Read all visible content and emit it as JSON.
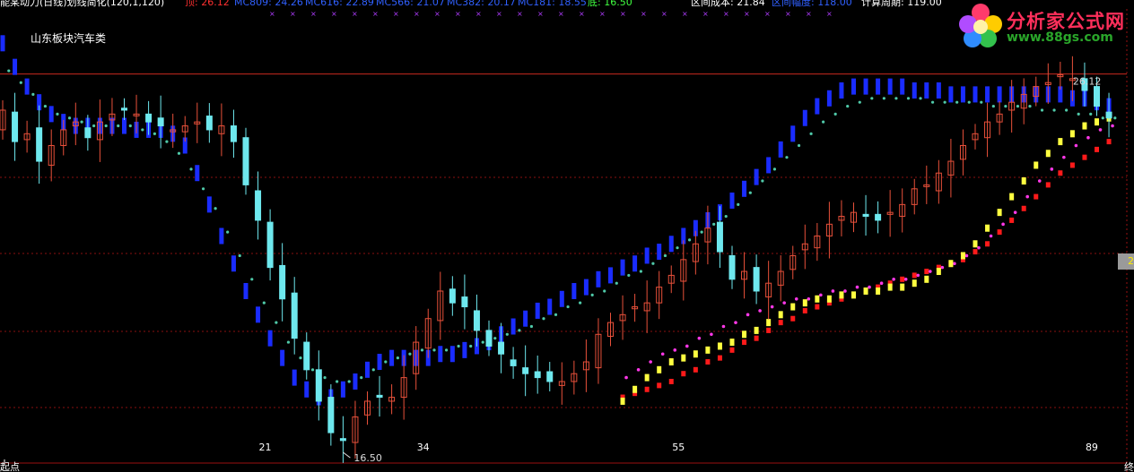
{
  "header": {
    "indicator_title": "能某动力(日线)划线简化(120,1,120)",
    "top_label": "顶: 26.12",
    "ma_items": [
      {
        "label": "MC809: 24.26",
        "color": "#3060ff"
      },
      {
        "label": "MC616: 22.89",
        "color": "#3060ff"
      },
      {
        "label": "MC566: 21.07",
        "color": "#3060ff"
      },
      {
        "label": "MC382: 20.17",
        "color": "#3060ff"
      },
      {
        "label": "MC181: 18.55",
        "color": "#3060ff"
      }
    ],
    "bottom_label": "底: 16.50",
    "cost_label": "区间成本: 21.84",
    "range_label": "区间幅度: 118.00",
    "period_label": "计算周期: 119.00"
  },
  "sector_label": "山东板块汽车类",
  "start_label": "起点",
  "end_label": "终",
  "right_tag": "2",
  "logo": {
    "title": "分析家公式网",
    "url": "www.88gs.com"
  },
  "colors": {
    "background": "#000000",
    "up_candle": "#e8503a",
    "down_candle": "#6ee8ee",
    "blue_band": "#1a2cff",
    "teal_dots": "#4fc9a8",
    "magenta_dots": "#ff38e8",
    "yellow_band": "#ffff40",
    "red_band": "#ff1a1a",
    "grid": "#8a1010",
    "label_text": "#d9d9d9",
    "header_red": "#ff3030",
    "header_white": "#ffffff",
    "header_yellow": "#ffff40",
    "header_green": "#40ff40"
  },
  "chart_data": {
    "type": "candlestick",
    "ylim": [
      16.0,
      28.0
    ],
    "high_label": "26.12",
    "low_label": "16.50",
    "x_ticks": [
      {
        "index": 21,
        "label": "21"
      },
      {
        "index": 34,
        "label": "34"
      },
      {
        "index": 55,
        "label": "55"
      },
      {
        "index": 89,
        "label": "89"
      }
    ],
    "closes": [
      25.2,
      24.4,
      24.6,
      23.9,
      24.3,
      24.7,
      24.9,
      24.5,
      24.9,
      25.1,
      25.2,
      25.1,
      24.9,
      24.8,
      24.7,
      24.8,
      24.9,
      24.7,
      24.8,
      24.4,
      23.3,
      22.4,
      21.2,
      20.4,
      19.4,
      18.6,
      17.8,
      17.0,
      16.8,
      17.4,
      17.8,
      17.9,
      17.9,
      18.4,
      19.3,
      19.9,
      20.6,
      20.3,
      20.2,
      19.6,
      19.2,
      19.0,
      18.7,
      18.5,
      18.4,
      18.3,
      18.3,
      18.5,
      18.8,
      19.5,
      19.8,
      20.0,
      20.2,
      20.3,
      20.7,
      21.0,
      21.4,
      21.8,
      22.2,
      21.6,
      20.9,
      21.1,
      20.6,
      20.8,
      21.1,
      21.5,
      21.8,
      22.0,
      22.3,
      22.5,
      22.6,
      22.5,
      22.4,
      22.6,
      22.8,
      23.2,
      23.3,
      23.6,
      23.9,
      24.3,
      24.6,
      24.9,
      25.1,
      25.4,
      25.6,
      25.8,
      25.9,
      26.1,
      26.0,
      25.7,
      25.3,
      25.0
    ],
    "ma_blue": [
      26.9,
      26.3,
      25.8,
      25.4,
      25.1,
      24.9,
      24.8,
      24.8,
      24.8,
      24.8,
      24.8,
      24.7,
      24.7,
      24.7,
      24.6,
      24.3,
      23.6,
      22.8,
      22.0,
      21.3,
      20.6,
      20.0,
      19.4,
      18.9,
      18.4,
      18.1,
      17.9,
      17.9,
      18.1,
      18.3,
      18.6,
      18.8,
      18.9,
      18.9,
      18.9,
      18.9,
      19.0,
      19.0,
      19.1,
      19.2,
      19.3,
      19.5,
      19.7,
      19.9,
      20.1,
      20.2,
      20.4,
      20.6,
      20.7,
      20.9,
      21.0,
      21.2,
      21.3,
      21.5,
      21.6,
      21.8,
      22.0,
      22.2,
      22.4,
      22.6,
      22.9,
      23.2,
      23.5,
      23.8,
      24.2,
      24.6,
      25.0,
      25.3,
      25.5,
      25.7,
      25.8,
      25.8,
      25.8,
      25.8,
      25.8,
      25.7,
      25.7,
      25.7,
      25.6,
      25.6,
      25.6,
      25.6,
      25.6,
      25.6,
      25.6,
      25.6,
      25.6,
      25.6,
      25.5,
      25.5,
      25.4,
      25.3
    ],
    "ma_teal": [
      26.2,
      25.9,
      25.6,
      25.3,
      25.1,
      25.0,
      24.9,
      24.8,
      24.8,
      24.8,
      24.8,
      24.7,
      24.6,
      24.4,
      24.1,
      23.7,
      23.2,
      22.7,
      22.1,
      21.5,
      20.9,
      20.3,
      19.8,
      19.3,
      18.9,
      18.6,
      18.4,
      18.3,
      18.3,
      18.4,
      18.6,
      18.8,
      18.9,
      19.0,
      19.1,
      19.1,
      19.1,
      19.2,
      19.2,
      19.3,
      19.4,
      19.5,
      19.6,
      19.7,
      19.9,
      20.0,
      20.2,
      20.3,
      20.5,
      20.6,
      20.8,
      21.0,
      21.1,
      21.3,
      21.5,
      21.7,
      21.9,
      22.1,
      22.3,
      22.5,
      22.8,
      23.1,
      23.4,
      23.7,
      24.0,
      24.3,
      24.6,
      24.9,
      25.1,
      25.3,
      25.4,
      25.5,
      25.5,
      25.5,
      25.5,
      25.5,
      25.4,
      25.4,
      25.4,
      25.4,
      25.4,
      25.3,
      25.3,
      25.3,
      25.3,
      25.2,
      25.2,
      25.2,
      25.1,
      25.1,
      25.0,
      25.0
    ],
    "band_yellow": [
      17.8,
      18.1,
      18.4,
      18.6,
      18.8,
      18.9,
      19.0,
      19.1,
      19.2,
      19.3,
      19.5,
      19.6,
      19.8,
      20.0,
      20.2,
      20.3,
      20.4,
      20.4,
      20.5,
      20.5,
      20.6,
      20.6,
      20.7,
      20.7,
      20.8,
      20.9,
      21.1,
      21.3,
      21.5,
      21.8,
      22.2,
      22.6,
      23.0,
      23.4,
      23.8,
      24.1,
      24.4,
      24.6,
      24.8,
      24.9,
      25.0
    ],
    "band_magenta": [
      18.4,
      18.6,
      18.8,
      19.0,
      19.1,
      19.2,
      19.4,
      19.5,
      19.7,
      19.8,
      20.0,
      20.1,
      20.2,
      20.3,
      20.4,
      20.4,
      20.5,
      20.6,
      20.6,
      20.7,
      20.7,
      20.8,
      20.9,
      20.9,
      21.0,
      21.1,
      21.2,
      21.3,
      21.5,
      21.7,
      22.0,
      22.3,
      22.6,
      23.0,
      23.4,
      23.7,
      24.0,
      24.3,
      24.5,
      24.7,
      24.8
    ],
    "band_red": [
      17.9,
      18.0,
      18.1,
      18.2,
      18.3,
      18.5,
      18.6,
      18.8,
      18.9,
      19.1,
      19.3,
      19.4,
      19.6,
      19.8,
      19.9,
      20.1,
      20.2,
      20.3,
      20.4,
      20.5,
      20.6,
      20.7,
      20.8,
      20.9,
      21.0,
      21.1,
      21.2,
      21.3,
      21.4,
      21.6,
      21.8,
      22.1,
      22.4,
      22.7,
      23.0,
      23.3,
      23.6,
      23.8,
      24.0,
      24.2,
      24.4
    ]
  }
}
